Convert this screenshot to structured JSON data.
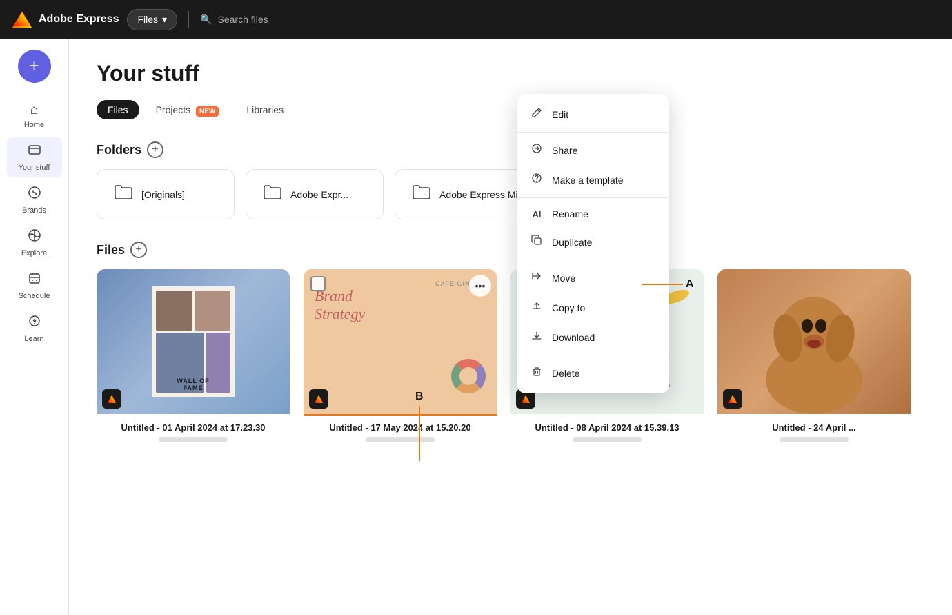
{
  "app": {
    "name": "Adobe Express",
    "dropdown_label": "Files",
    "search_placeholder": "Search files"
  },
  "sidebar": {
    "new_button_label": "+",
    "items": [
      {
        "id": "home",
        "label": "Home",
        "icon": "⌂"
      },
      {
        "id": "your-stuff",
        "label": "Your stuff",
        "icon": "🗂"
      },
      {
        "id": "brands",
        "label": "Brands",
        "icon": "🅱"
      },
      {
        "id": "explore",
        "label": "Explore",
        "icon": "⊘"
      },
      {
        "id": "schedule",
        "label": "Schedule",
        "icon": "📅"
      },
      {
        "id": "learn",
        "label": "Learn",
        "icon": "💡"
      }
    ]
  },
  "page": {
    "title": "Your stuff",
    "tabs": [
      {
        "id": "files",
        "label": "Files",
        "active": true
      },
      {
        "id": "projects",
        "label": "Projects",
        "badge": "NEW"
      },
      {
        "id": "libraries",
        "label": "Libraries"
      }
    ]
  },
  "folders_section": {
    "title": "Folders",
    "folders": [
      {
        "name": "[Originals]"
      },
      {
        "name": "Adobe Expr..."
      },
      {
        "name": "Adobe Express Microsoft E..."
      }
    ]
  },
  "files_section": {
    "title": "Files",
    "files": [
      {
        "title": "Untitled - 01 April 2024 at 17.23.30",
        "type": "wall-of-fame"
      },
      {
        "title": "Untitled - 17 May 2024 at 15.20.20",
        "type": "brand-strategy"
      },
      {
        "title": "Untitled - 08 April 2024 at 15.39.13",
        "type": "dog-circle"
      },
      {
        "title": "Untitled - 24 April ...",
        "type": "dog-orange"
      }
    ]
  },
  "context_menu": {
    "items": [
      {
        "id": "edit",
        "label": "Edit",
        "icon": "✏"
      },
      {
        "id": "share",
        "label": "Share",
        "icon": "↗"
      },
      {
        "id": "make-template",
        "label": "Make a template",
        "icon": "⊙"
      },
      {
        "id": "rename",
        "label": "Rename",
        "icon": "AI"
      },
      {
        "id": "duplicate",
        "label": "Duplicate",
        "icon": "⊕"
      },
      {
        "id": "move",
        "label": "Move",
        "icon": "↪"
      },
      {
        "id": "copy-to",
        "label": "Copy to",
        "icon": "⤴"
      },
      {
        "id": "download",
        "label": "Download",
        "icon": "⬇"
      },
      {
        "id": "delete",
        "label": "Delete",
        "icon": "🗑"
      }
    ]
  },
  "annotations": {
    "a_label": "A",
    "b_label": "B"
  }
}
